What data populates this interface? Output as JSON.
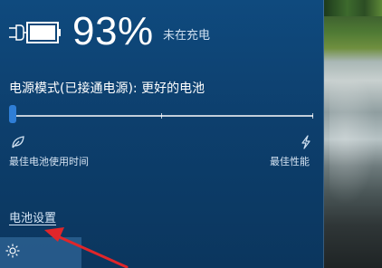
{
  "battery": {
    "percent": "93%",
    "status": "未在充电",
    "level": 0.93
  },
  "power_mode": {
    "title": "电源模式(已接通电源): 更好的电池",
    "left_label": "最佳电池使用时间",
    "right_label": "最佳性能",
    "slider_position": 0
  },
  "links": {
    "battery_settings": "电池设置"
  },
  "icons": {
    "battery": "battery-plugged-icon",
    "leaf": "leaf-icon",
    "lightning": "lightning-icon",
    "sun": "brightness-icon"
  },
  "colors": {
    "panel_bg": "#0d3f6d",
    "accent": "#2f7ed6",
    "annotation_arrow": "#e0262a"
  }
}
